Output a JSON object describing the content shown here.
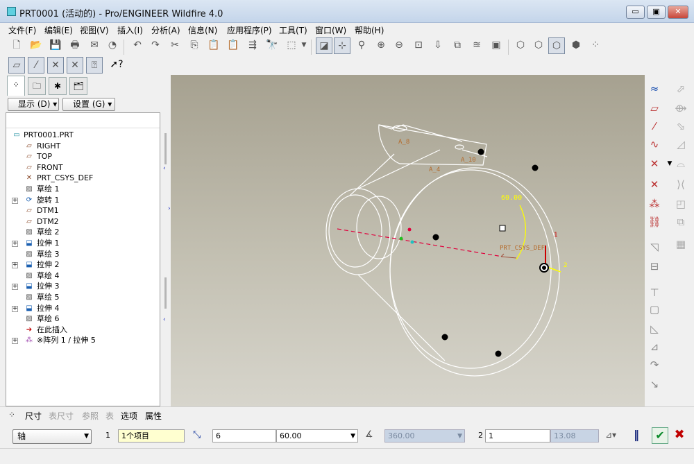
{
  "window": {
    "title": "PRT0001 (活动的) - Pro/ENGINEER Wildfire 4.0",
    "min": "▭",
    "max": "▣",
    "close": "✕"
  },
  "menu": [
    "文件(F)",
    "编辑(E)",
    "视图(V)",
    "插入(I)",
    "分析(A)",
    "信息(N)",
    "应用程序(P)",
    "工具(T)",
    "窗口(W)",
    "帮助(H)"
  ],
  "toolbar1": [
    "new-icon",
    "open-icon",
    "save-icon",
    "print-icon",
    "send-icon",
    "undo-icon",
    "redo-icon",
    "cut-icon",
    "copy-icon",
    "paste-icon",
    "regenerate-icon",
    "find-icon",
    "select-box-icon",
    "repaint-icon",
    "spin-center-icon",
    "orient-icon",
    "zoom-in-icon",
    "zoom-out-icon",
    "refit-icon",
    "view-manager-icon",
    "saved-views-icon",
    "layers-icon",
    "model-display-icon",
    "wireframe-icon",
    "hidden-line-icon",
    "no-hidden-icon",
    "shading-icon",
    "model-tree-icon"
  ],
  "toolbar2": [
    "datum-plane-display-icon",
    "datum-axis-display-icon",
    "datum-point-display-icon",
    "csys-display-icon",
    "annotation-display-icon",
    "context-help-icon"
  ],
  "model_tree": {
    "tabs": [
      "model-tree-tab",
      "folder-browser-tab",
      "favorites-tab",
      "connections-tab"
    ],
    "show_label": "显示 (D) ▾",
    "settings_label": "设置 (G) ▾",
    "items": [
      {
        "label": "PRT0001.PRT",
        "icon": "part-icon",
        "expand": false,
        "root": true
      },
      {
        "label": "RIGHT",
        "icon": "datum-plane-icon",
        "expand": false
      },
      {
        "label": "TOP",
        "icon": "datum-plane-icon",
        "expand": false
      },
      {
        "label": "FRONT",
        "icon": "datum-plane-icon",
        "expand": false
      },
      {
        "label": "PRT_CSYS_DEF",
        "icon": "csys-icon",
        "expand": false
      },
      {
        "label": "草绘 1",
        "icon": "sketch-icon",
        "expand": false
      },
      {
        "label": "旋转 1",
        "icon": "revolve-icon",
        "expand": true
      },
      {
        "label": "DTM1",
        "icon": "datum-plane-icon",
        "expand": false
      },
      {
        "label": "DTM2",
        "icon": "datum-plane-icon",
        "expand": false
      },
      {
        "label": "草绘 2",
        "icon": "sketch-icon",
        "expand": false
      },
      {
        "label": "拉伸 1",
        "icon": "extrude-icon",
        "expand": true
      },
      {
        "label": "草绘 3",
        "icon": "sketch-icon",
        "expand": false
      },
      {
        "label": "拉伸 2",
        "icon": "extrude-icon",
        "expand": true
      },
      {
        "label": "草绘 4",
        "icon": "sketch-icon",
        "expand": false
      },
      {
        "label": "拉伸 3",
        "icon": "extrude-icon",
        "expand": true
      },
      {
        "label": "草绘 5",
        "icon": "sketch-icon",
        "expand": false
      },
      {
        "label": "拉伸 4",
        "icon": "extrude-icon",
        "expand": true
      },
      {
        "label": "草绘 6",
        "icon": "sketch-icon",
        "expand": false
      },
      {
        "label": "在此插入",
        "icon": "insert-here-icon",
        "expand": false
      },
      {
        "label": "※阵列 1 / 拉伸 5",
        "icon": "pattern-icon",
        "expand": true
      }
    ]
  },
  "viewport": {
    "dims": [
      "A_8",
      "A_10",
      "A_4",
      "60.00",
      "PRT_CSYS_DEF",
      "1",
      "2"
    ],
    "bg_top": "#a6a190",
    "bg_bottom": "#d7d5cc"
  },
  "right_tools": [
    "datum-plane-icon",
    "datum-axis-icon",
    "datum-curve-icon",
    "sketch-tool-icon",
    "datum-point-icon",
    "csys-tool-icon",
    "analysis-feature-icon",
    "hole-icon",
    "shell-icon",
    "rib-icon",
    "draft-icon",
    "round-icon",
    "chamfer-icon",
    "pattern-tool-icon",
    "mirror-icon",
    "merge-icon",
    "trim-icon",
    "extend-icon",
    "offset-icon",
    "thicken-icon",
    "intersect-icon",
    "solidify-icon",
    "project-icon",
    "wrap-icon"
  ],
  "dashboard": {
    "tabs": [
      {
        "label": "尺寸",
        "dim": false
      },
      {
        "label": "表尺寸",
        "dim": true
      },
      {
        "label": "参照",
        "dim": true
      },
      {
        "label": "表",
        "dim": true
      },
      {
        "label": "选项",
        "dim": false
      },
      {
        "label": "属性",
        "dim": false
      }
    ],
    "type_combo": "轴",
    "dir1_num": "1",
    "dir1_field": "1个项目",
    "count_field": "6",
    "angle_field": "60.00",
    "total_angle": "360.00",
    "dir2_num": "2",
    "dir2_count": "1",
    "dir2_value": "13.08",
    "accept_icon": "✔",
    "cancel_icon": "✖",
    "pause_icon": "‖"
  }
}
